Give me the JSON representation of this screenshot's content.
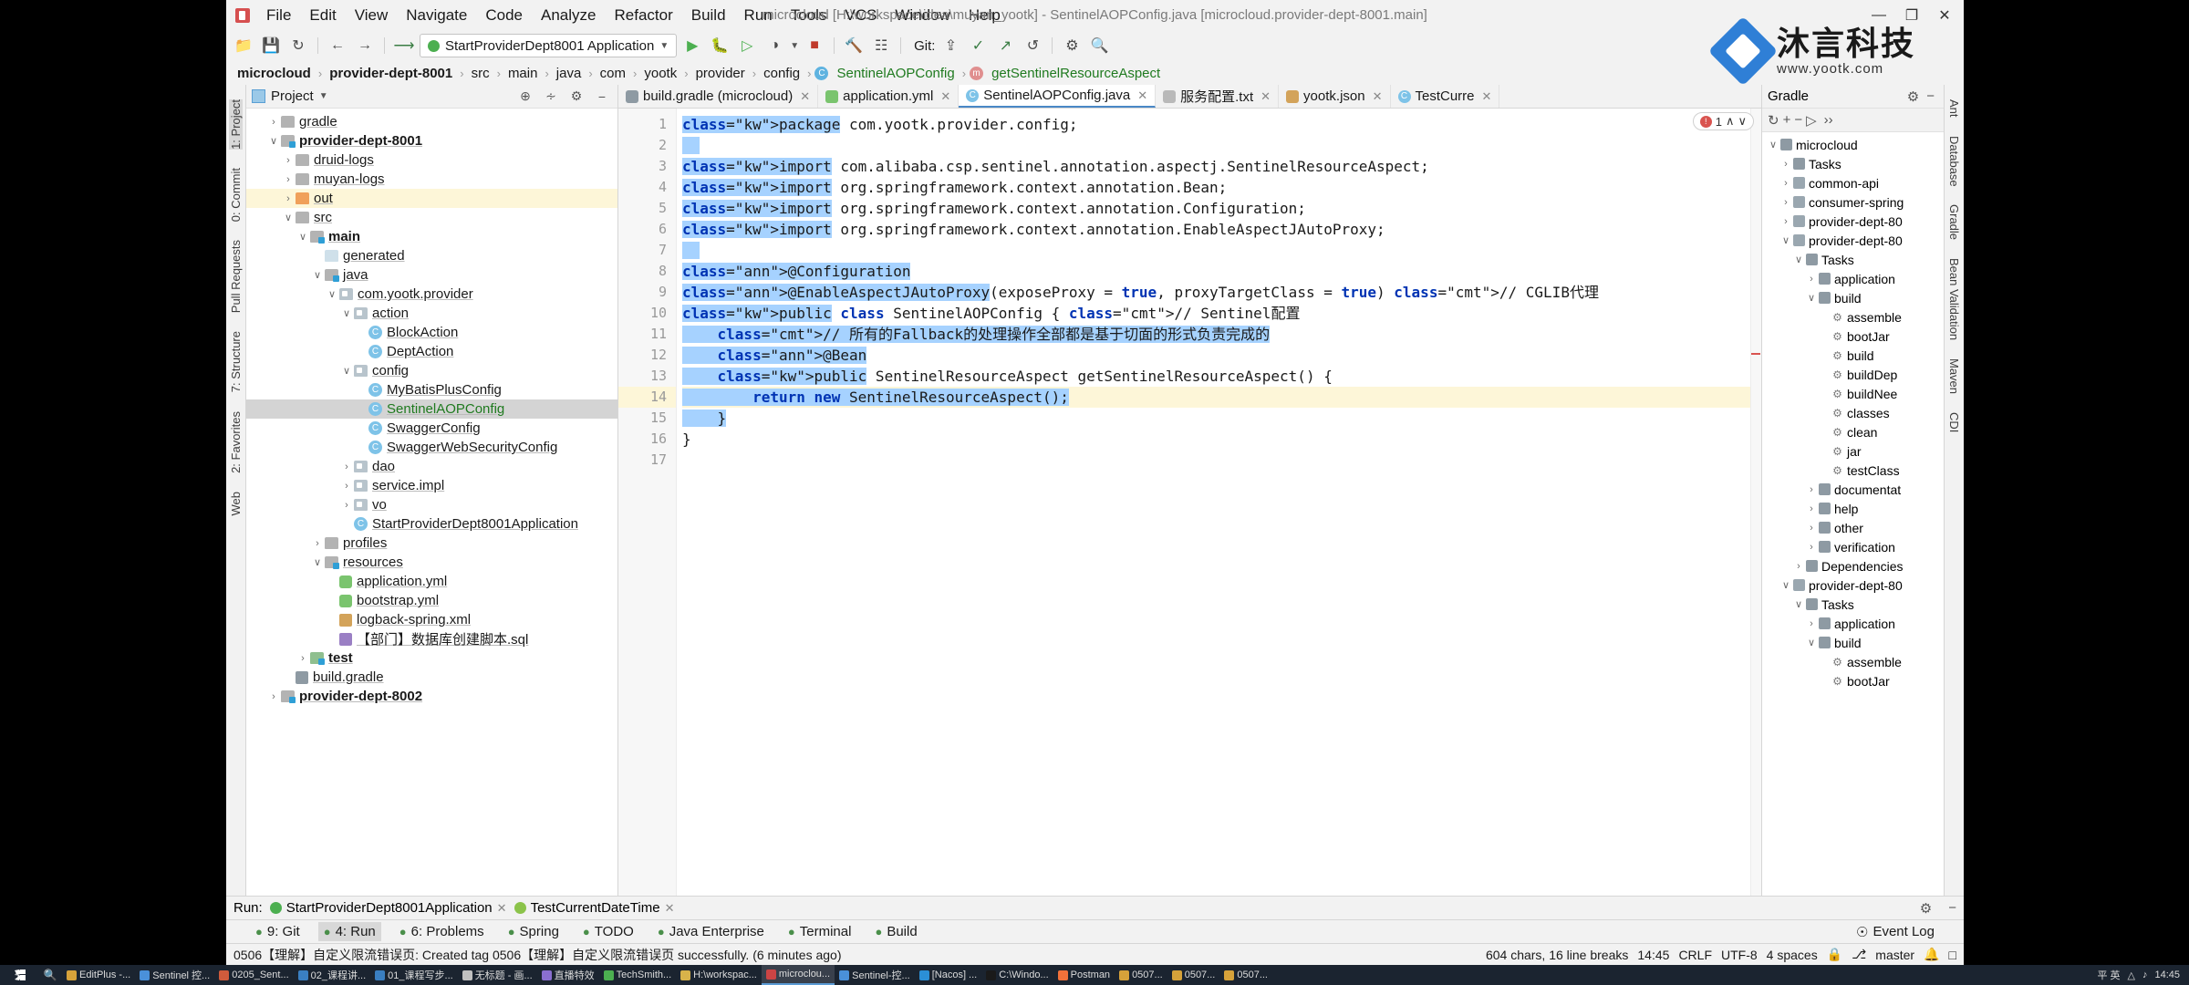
{
  "window": {
    "title": "microcloud [H:\\workspace\\idea\\muyan_yootk] - SentinelAOPConfig.java [microcloud.provider-dept-8001.main]",
    "minimize": "—",
    "maximize": "❐",
    "close": "✕"
  },
  "menu": [
    "File",
    "Edit",
    "View",
    "Navigate",
    "Code",
    "Analyze",
    "Refactor",
    "Build",
    "Run",
    "Tools",
    "VCS",
    "Window",
    "Help"
  ],
  "toolbar": {
    "run_config": "StartProviderDept8001 Application",
    "git_label": "Git:",
    "icons": [
      "open-folder-icon",
      "save-all-icon",
      "sync-icon",
      "back-icon",
      "forward-icon",
      "undo-icon"
    ],
    "right_icons": [
      "run-icon",
      "debug-icon",
      "run-with-coverage-icon",
      "profile-icon",
      "stop-icon",
      "hammer-icon",
      "search-everywhere-icon"
    ]
  },
  "breadcrumb": [
    {
      "text": "microcloud",
      "bold": true,
      "kind": "module"
    },
    {
      "text": "provider-dept-8001",
      "bold": true,
      "kind": "module"
    },
    {
      "text": "src",
      "bold": false,
      "kind": "dir"
    },
    {
      "text": "main",
      "bold": false,
      "kind": "dir"
    },
    {
      "text": "java",
      "bold": false,
      "kind": "dir"
    },
    {
      "text": "com",
      "bold": false,
      "kind": "dir"
    },
    {
      "text": "yootk",
      "bold": false,
      "kind": "dir"
    },
    {
      "text": "provider",
      "bold": false,
      "kind": "dir"
    },
    {
      "text": "config",
      "bold": false,
      "kind": "dir"
    },
    {
      "text": "SentinelAOPConfig",
      "bold": false,
      "kind": "class"
    },
    {
      "text": "getSentinelResourceAspect",
      "bold": false,
      "kind": "method"
    }
  ],
  "left_rail": [
    "1: Project",
    "0: Commit",
    "Pull Requests",
    "7: Structure",
    "2: Favorites",
    "Web"
  ],
  "right_rail": [
    "Ant",
    "Database",
    "Gradle",
    "Bean Validation",
    "Maven",
    "CDI"
  ],
  "project_panel": {
    "title": "Project",
    "tree": [
      {
        "depth": 1,
        "arrow": "›",
        "icon": "folder",
        "label": "gradle",
        "bold": false,
        "state": "normal"
      },
      {
        "depth": 1,
        "arrow": "∨",
        "icon": "folder-src",
        "label": "provider-dept-8001",
        "bold": true,
        "state": "normal"
      },
      {
        "depth": 2,
        "arrow": "›",
        "icon": "folder",
        "label": "druid-logs",
        "bold": false,
        "state": "normal"
      },
      {
        "depth": 2,
        "arrow": "›",
        "icon": "folder",
        "label": "muyan-logs",
        "bold": false,
        "state": "normal"
      },
      {
        "depth": 2,
        "arrow": "›",
        "icon": "folder-orange",
        "label": "out",
        "bold": false,
        "state": "highlight"
      },
      {
        "depth": 2,
        "arrow": "∨",
        "icon": "folder",
        "label": "src",
        "bold": false,
        "state": "normal"
      },
      {
        "depth": 3,
        "arrow": "∨",
        "icon": "folder-src",
        "label": "main",
        "bold": true,
        "state": "normal"
      },
      {
        "depth": 4,
        "arrow": "",
        "icon": "folder-generated",
        "label": "generated",
        "bold": false,
        "state": "normal"
      },
      {
        "depth": 4,
        "arrow": "∨",
        "icon": "folder-src",
        "label": "java",
        "bold": false,
        "state": "normal"
      },
      {
        "depth": 5,
        "arrow": "∨",
        "icon": "package",
        "label": "com.yootk.provider",
        "bold": false,
        "state": "normal"
      },
      {
        "depth": 6,
        "arrow": "∨",
        "icon": "package",
        "label": "action",
        "bold": false,
        "state": "normal"
      },
      {
        "depth": 7,
        "arrow": "",
        "icon": "class",
        "label": "BlockAction",
        "bold": false,
        "state": "normal"
      },
      {
        "depth": 7,
        "arrow": "",
        "icon": "class",
        "label": "DeptAction",
        "bold": false,
        "state": "normal"
      },
      {
        "depth": 6,
        "arrow": "∨",
        "icon": "package",
        "label": "config",
        "bold": false,
        "state": "normal"
      },
      {
        "depth": 7,
        "arrow": "",
        "icon": "class",
        "label": "MyBatisPlusConfig",
        "bold": false,
        "state": "normal"
      },
      {
        "depth": 7,
        "arrow": "",
        "icon": "class",
        "label": "SentinelAOPConfig",
        "bold": false,
        "state": "selected"
      },
      {
        "depth": 7,
        "arrow": "",
        "icon": "class",
        "label": "SwaggerConfig",
        "bold": false,
        "state": "normal"
      },
      {
        "depth": 7,
        "arrow": "",
        "icon": "class",
        "label": "SwaggerWebSecurityConfig",
        "bold": false,
        "state": "normal"
      },
      {
        "depth": 6,
        "arrow": "›",
        "icon": "package",
        "label": "dao",
        "bold": false,
        "state": "normal"
      },
      {
        "depth": 6,
        "arrow": "›",
        "icon": "package",
        "label": "service.impl",
        "bold": false,
        "state": "normal"
      },
      {
        "depth": 6,
        "arrow": "›",
        "icon": "package",
        "label": "vo",
        "bold": false,
        "state": "normal"
      },
      {
        "depth": 6,
        "arrow": "",
        "icon": "class",
        "label": "StartProviderDept8001Application",
        "bold": false,
        "state": "normal"
      },
      {
        "depth": 4,
        "arrow": "›",
        "icon": "folder",
        "label": "profiles",
        "bold": false,
        "state": "normal"
      },
      {
        "depth": 4,
        "arrow": "∨",
        "icon": "folder-res",
        "label": "resources",
        "bold": false,
        "state": "normal"
      },
      {
        "depth": 5,
        "arrow": "",
        "icon": "yml",
        "label": "application.yml",
        "bold": false,
        "state": "normal"
      },
      {
        "depth": 5,
        "arrow": "",
        "icon": "yml",
        "label": "bootstrap.yml",
        "bold": false,
        "state": "normal"
      },
      {
        "depth": 5,
        "arrow": "",
        "icon": "xml",
        "label": "logback-spring.xml",
        "bold": false,
        "state": "normal"
      },
      {
        "depth": 5,
        "arrow": "",
        "icon": "sql",
        "label": "【部门】数据库创建脚本.sql",
        "bold": false,
        "state": "normal"
      },
      {
        "depth": 3,
        "arrow": "›",
        "icon": "folder-test",
        "label": "test",
        "bold": true,
        "state": "normal"
      },
      {
        "depth": 2,
        "arrow": "",
        "icon": "gradle",
        "label": "build.gradle",
        "bold": false,
        "state": "normal"
      },
      {
        "depth": 1,
        "arrow": "›",
        "icon": "folder-src",
        "label": "provider-dept-8002",
        "bold": true,
        "state": "normal"
      }
    ]
  },
  "editor": {
    "tabs": [
      {
        "label": "build.gradle (microcloud)",
        "icon": "gradle-icon",
        "active": false,
        "closable": true
      },
      {
        "label": "application.yml",
        "icon": "yaml-icon",
        "active": false,
        "closable": true
      },
      {
        "label": "SentinelAOPConfig.java",
        "icon": "class-icon",
        "active": true,
        "closable": true
      },
      {
        "label": "服务配置.txt",
        "icon": "text-icon",
        "active": false,
        "closable": true
      },
      {
        "label": "yootk.json",
        "icon": "json-icon",
        "active": false,
        "closable": true
      },
      {
        "label": "TestCurre",
        "icon": "class-icon",
        "active": false,
        "closable": true
      }
    ],
    "inspection": {
      "error_count": "1",
      "up": "∧",
      "down": "∨"
    },
    "lines": [
      {
        "n": 1,
        "text": "package com.yootk.provider.config;",
        "selected": true
      },
      {
        "n": 2,
        "text": "",
        "selected": true
      },
      {
        "n": 3,
        "text": "import com.alibaba.csp.sentinel.annotation.aspectj.SentinelResourceAspect;",
        "selected": true,
        "fold": true
      },
      {
        "n": 4,
        "text": "import org.springframework.context.annotation.Bean;",
        "selected": true
      },
      {
        "n": 5,
        "text": "import org.springframework.context.annotation.Configuration;",
        "selected": true
      },
      {
        "n": 6,
        "text": "import org.springframework.context.annotation.EnableAspectJAutoProxy;",
        "selected": true,
        "fold": true
      },
      {
        "n": 7,
        "text": "",
        "selected": true
      },
      {
        "n": 8,
        "text": "@Configuration",
        "selected": true,
        "fold": true
      },
      {
        "n": 9,
        "text": "@EnableAspectJAutoProxy(exposeProxy = true, proxyTargetClass = true) // CGLIB代理",
        "selected": true
      },
      {
        "n": 10,
        "text": "public class SentinelAOPConfig { // Sentinel配置",
        "selected": true,
        "fold": true,
        "gutter_icon": "run-class-icon"
      },
      {
        "n": 11,
        "text": "    // 所有的Fallback的处理操作全部都是基于切面的形式负责完成的",
        "selected": true
      },
      {
        "n": 12,
        "text": "    @Bean",
        "selected": true,
        "gutter_icon": "bean-icon"
      },
      {
        "n": 13,
        "text": "    public SentinelResourceAspect getSentinelResourceAspect() {",
        "selected": true,
        "fold": true
      },
      {
        "n": 14,
        "text": "        return new SentinelResourceAspect();",
        "selected": true,
        "caret": true,
        "current": true
      },
      {
        "n": 15,
        "text": "    }",
        "selected": true
      },
      {
        "n": 16,
        "text": "}",
        "selected": false
      },
      {
        "n": 17,
        "text": "",
        "selected": false
      }
    ]
  },
  "gradle_panel": {
    "title": "Gradle",
    "toolbar_icons": [
      "refresh-icon",
      "add-icon",
      "minus-icon",
      "run-task-icon",
      "more-icon"
    ],
    "header_icons": [
      "gear-icon",
      "minimize-icon"
    ],
    "tree": [
      {
        "depth": 0,
        "arrow": "∨",
        "icon": "gradle",
        "label": "microcloud"
      },
      {
        "depth": 1,
        "arrow": "›",
        "icon": "folder",
        "label": "Tasks"
      },
      {
        "depth": 1,
        "arrow": "›",
        "icon": "module",
        "label": "common-api"
      },
      {
        "depth": 1,
        "arrow": "›",
        "icon": "module",
        "label": "consumer-spring"
      },
      {
        "depth": 1,
        "arrow": "›",
        "icon": "module",
        "label": "provider-dept-80"
      },
      {
        "depth": 1,
        "arrow": "∨",
        "icon": "module",
        "label": "provider-dept-80"
      },
      {
        "depth": 2,
        "arrow": "∨",
        "icon": "folder",
        "label": "Tasks"
      },
      {
        "depth": 3,
        "arrow": "›",
        "icon": "folder",
        "label": "application"
      },
      {
        "depth": 3,
        "arrow": "∨",
        "icon": "folder",
        "label": "build"
      },
      {
        "depth": 4,
        "arrow": "",
        "icon": "gear",
        "label": "assemble"
      },
      {
        "depth": 4,
        "arrow": "",
        "icon": "gear",
        "label": "bootJar"
      },
      {
        "depth": 4,
        "arrow": "",
        "icon": "gear",
        "label": "build"
      },
      {
        "depth": 4,
        "arrow": "",
        "icon": "gear",
        "label": "buildDep"
      },
      {
        "depth": 4,
        "arrow": "",
        "icon": "gear",
        "label": "buildNee"
      },
      {
        "depth": 4,
        "arrow": "",
        "icon": "gear",
        "label": "classes"
      },
      {
        "depth": 4,
        "arrow": "",
        "icon": "gear",
        "label": "clean"
      },
      {
        "depth": 4,
        "arrow": "",
        "icon": "gear",
        "label": "jar"
      },
      {
        "depth": 4,
        "arrow": "",
        "icon": "gear",
        "label": "testClass"
      },
      {
        "depth": 3,
        "arrow": "›",
        "icon": "folder",
        "label": "documentat"
      },
      {
        "depth": 3,
        "arrow": "›",
        "icon": "folder",
        "label": "help"
      },
      {
        "depth": 3,
        "arrow": "›",
        "icon": "folder",
        "label": "other"
      },
      {
        "depth": 3,
        "arrow": "›",
        "icon": "folder",
        "label": "verification"
      },
      {
        "depth": 2,
        "arrow": "›",
        "icon": "folder",
        "label": "Dependencies"
      },
      {
        "depth": 1,
        "arrow": "∨",
        "icon": "module",
        "label": "provider-dept-80"
      },
      {
        "depth": 2,
        "arrow": "∨",
        "icon": "folder",
        "label": "Tasks"
      },
      {
        "depth": 3,
        "arrow": "›",
        "icon": "folder",
        "label": "application"
      },
      {
        "depth": 3,
        "arrow": "∨",
        "icon": "folder",
        "label": "build"
      },
      {
        "depth": 4,
        "arrow": "",
        "icon": "gear",
        "label": "assemble"
      },
      {
        "depth": 4,
        "arrow": "",
        "icon": "gear",
        "label": "bootJar"
      }
    ]
  },
  "run_strip": {
    "label": "Run:",
    "tabs": [
      {
        "label": "StartProviderDept8001Application",
        "active": true
      },
      {
        "label": "TestCurrentDateTime",
        "active": false
      }
    ],
    "right_icons": [
      "gear-icon",
      "minimize-icon"
    ]
  },
  "bottom_tabs": [
    {
      "label": "9: Git",
      "icon": "git-icon",
      "selected": false
    },
    {
      "label": "4: Run",
      "icon": "run-icon",
      "selected": true
    },
    {
      "label": "6: Problems",
      "icon": "problems-icon",
      "selected": false
    },
    {
      "label": "Spring",
      "icon": "spring-icon",
      "selected": false
    },
    {
      "label": "TODO",
      "icon": "todo-icon",
      "selected": false
    },
    {
      "label": "Java Enterprise",
      "icon": "java-ee-icon",
      "selected": false
    },
    {
      "label": "Terminal",
      "icon": "terminal-icon",
      "selected": false
    },
    {
      "label": "Build",
      "icon": "build-icon",
      "selected": false
    }
  ],
  "event_log": "Event Log",
  "status_bar": {
    "message": "0506【理解】自定义限流错误页: Created tag 0506【理解】自定义限流错误页 successfully. (6 minutes ago)",
    "chars": "604 chars, 16 line breaks",
    "time": "14:45",
    "line_sep": "CRLF",
    "encoding": "UTF-8",
    "indent": "4 spaces",
    "branch": "master",
    "branch_icon": "git-branch-icon",
    "lock_icon": "lock-icon"
  },
  "watermark": {
    "title": "沐言科技",
    "url": "www.yootk.com"
  },
  "taskbar": {
    "items": [
      {
        "label": "EditPlus -...",
        "color": "#d6a23a"
      },
      {
        "label": "Sentinel 控...",
        "color": "#4a90d9"
      },
      {
        "label": "0205_Sent...",
        "color": "#cf5b3c"
      },
      {
        "label": "02_课程讲...",
        "color": "#3a7fc1"
      },
      {
        "label": "01_课程写步...",
        "color": "#3a7fc1"
      },
      {
        "label": "无标题 - 画...",
        "color": "#c0c0c0"
      },
      {
        "label": "直播特效",
        "color": "#8a6fd0"
      },
      {
        "label": "TechSmith...",
        "color": "#4caf50"
      },
      {
        "label": "H:\\workspac...",
        "color": "#d8b34a"
      },
      {
        "label": "microclou...",
        "color": "#c44",
        "active": true
      },
      {
        "label": "Sentinel-控...",
        "color": "#4a90d9"
      },
      {
        "label": "[Nacos] ...",
        "color": "#2b8fd6"
      },
      {
        "label": "C:\\Windo...",
        "color": "#1a1a1a"
      },
      {
        "label": "Postman",
        "color": "#f2713a"
      },
      {
        "label": "0507...",
        "color": "#d6a23a"
      },
      {
        "label": "0507...",
        "color": "#d6a23a"
      },
      {
        "label": "0507...",
        "color": "#d6a23a"
      }
    ],
    "tray": [
      "平 英",
      "△",
      "♪",
      "14:45"
    ]
  }
}
